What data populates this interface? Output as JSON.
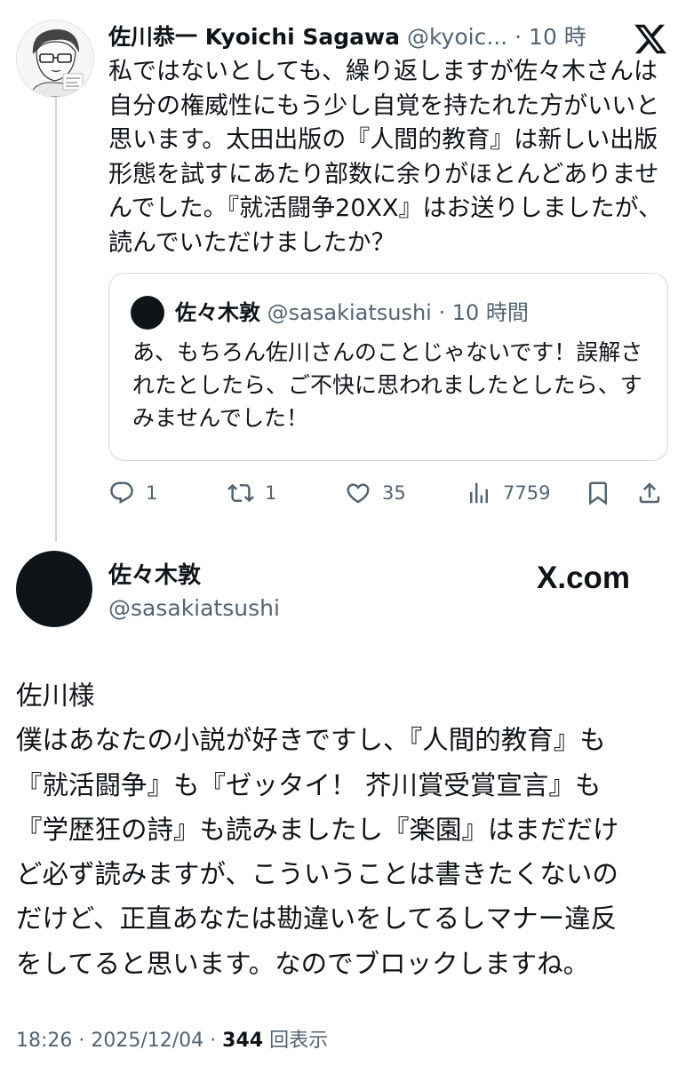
{
  "reply": {
    "author_name": "佐川恭一 Kyoichi Sagawa",
    "author_handle": "@kyoic...",
    "separator": "·",
    "time": "10 時間",
    "text": "私ではないとしても、繰り返しますが佐々木さんは自分の権威性にもう少し自覚を持たれた方がいいと思います。太田出版の『人間的教育』は新しい出版形態を試すにあたり部数に余りがほとんどありませんでした。『就活闘争20XX』はお送りしましたが、読んでいただけましたか？",
    "quote": {
      "author_name": "佐々木敦",
      "author_handle": "@sasakiatsushi",
      "separator": "·",
      "time": "10 時間",
      "text": "あ、もちろん佐川さんのことじゃないです！誤解されたとしたら、ご不快に思われましたとしたら、すみませんでした！"
    },
    "actions": {
      "replies": "1",
      "reposts": "1",
      "likes": "35",
      "views": "7759"
    }
  },
  "main": {
    "author_name": "佐々木敦",
    "author_handle": "@sasakiatsushi",
    "brand": "X.com",
    "text_lines": [
      "佐川様",
      "僕はあなたの小説が好きですし、『人間的教育』も",
      "『就活闘争』も『ゼッタイ！ 芥川賞受賞宣言』も",
      "『学歴狂の詩』も読みましたし『楽園』はまだだけ",
      "ど必ず読みますが、こういうことは書きたくないの",
      "だけど、正直あなたは勘違いをしてるしマナー違反",
      "をしてると思います。なのでブロックしますね。"
    ],
    "timestamp": "18:26 · 2025/12/04 ·",
    "view_count": "344",
    "view_label": "回表示"
  },
  "icons": [
    "x-logo-icon",
    "reply-icon",
    "repost-icon",
    "like-icon",
    "views-icon",
    "bookmark-icon",
    "share-icon"
  ]
}
